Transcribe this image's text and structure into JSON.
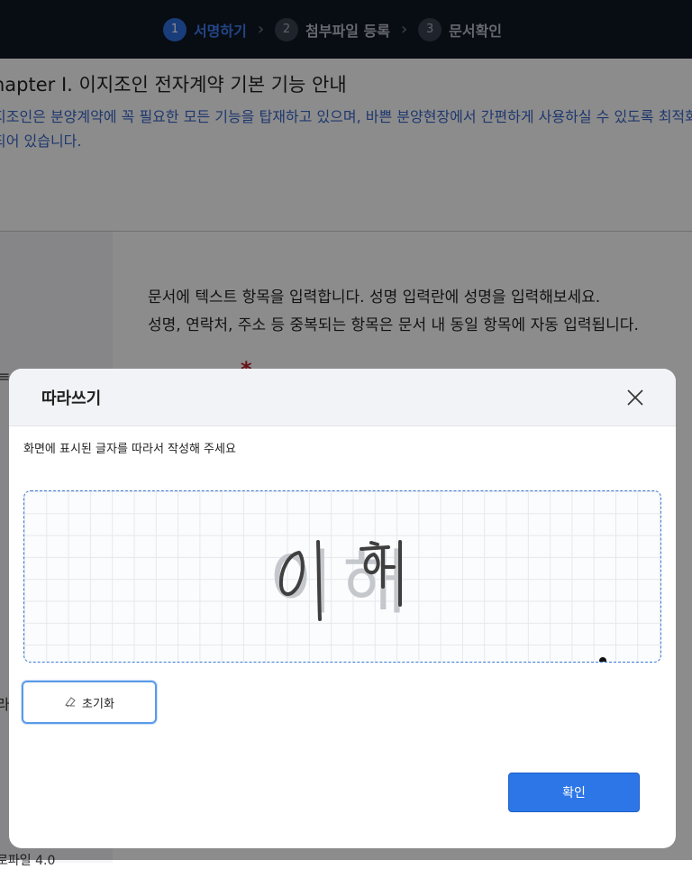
{
  "steps": [
    {
      "num": "1",
      "label": "서명하기"
    },
    {
      "num": "2",
      "label": "첨부파일 등록"
    },
    {
      "num": "3",
      "label": "문서확인"
    }
  ],
  "background": {
    "chapter": "hapter I. 이지조인 전자계약 기본 기능 안내",
    "intro": "지조인은 분양계약에 꼭 필요한 모든 기능을 탑재하고 있으며, 바쁜 분양현장에서 간편하게 사용하실 수 있도록 최적화 되어 있습니다.",
    "desc_line1": "문서에 텍스트 항목을 입력합니다. 성명 입력란에 성명을 입력해보세요.",
    "desc_line2": "성명, 연락처, 주소 등 중복되는 항목은 문서 내 동일 항목에 자동 입력됩니다.",
    "required_mark": "*",
    "left_glyph": "≡",
    "left_glyph2": "라",
    "bottom_text": "로파일 4.0"
  },
  "modal": {
    "title": "따라쓰기",
    "instruction": "화면에 표시된 글자를 따라서 작성해 주세요",
    "guide_text": "이해",
    "reset_label": "초기화",
    "confirm_label": "확인"
  },
  "colors": {
    "topbar": "#0f1724",
    "active_step": "#2f6fe0",
    "accent": "#2d76e8",
    "intro_text": "#3a66c8"
  },
  "icons": {
    "close": "close-icon",
    "reset": "eraser-icon",
    "step_separator": "chevron-right-icon"
  }
}
